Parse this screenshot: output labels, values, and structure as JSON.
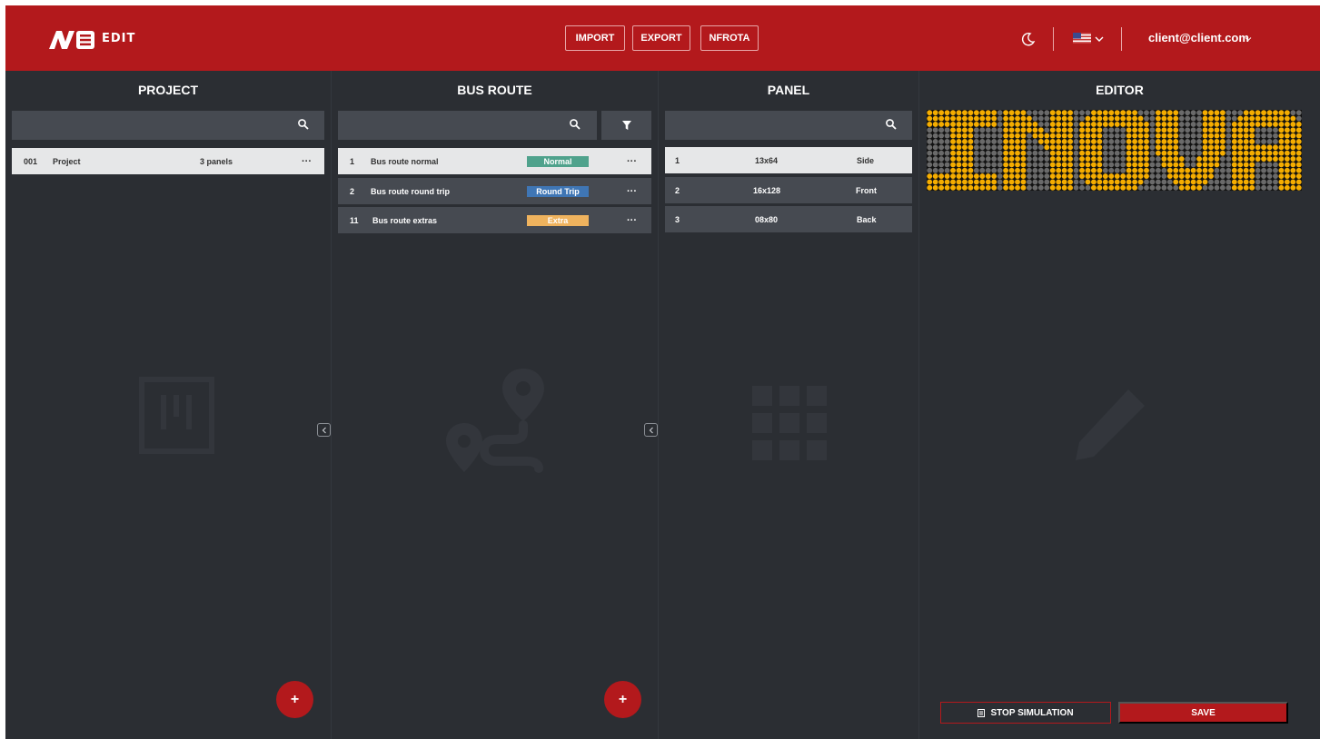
{
  "header": {
    "logo_text": "EDIT",
    "buttons": [
      "IMPORT",
      "EXPORT",
      "NFROTA"
    ],
    "user_email": "client@client.com",
    "theme_icon": "moon-icon",
    "language_icon": "us-flag-icon",
    "colors": {
      "brand": "#b3191c",
      "background": "#2b2e33",
      "row_dark": "#464a51"
    }
  },
  "project": {
    "title": "PROJECT",
    "search_placeholder": "",
    "items": [
      {
        "id": "001",
        "name": "Project",
        "count": "3 panels",
        "menu": "···"
      }
    ],
    "add_label": "+",
    "watermark_icon": "board-icon"
  },
  "bus_route": {
    "title": "BUS ROUTE",
    "search_placeholder": "",
    "items": [
      {
        "id": "1",
        "name": "Bus route normal",
        "type": "Normal",
        "type_color": "#4fa28c",
        "menu": "···"
      },
      {
        "id": "2",
        "name": "Bus route round trip",
        "type": "Round Trip",
        "type_color": "#3f76b5",
        "menu": "···"
      },
      {
        "id": "11",
        "name": "Bus route extras",
        "type": "Extra",
        "type_color": "#efb35e",
        "menu": "···"
      }
    ],
    "add_label": "+",
    "watermark_icon": "route-icon"
  },
  "panel": {
    "title": "PANEL",
    "search_placeholder": "",
    "items": [
      {
        "id": "1",
        "size": "13x64",
        "position": "Side"
      },
      {
        "id": "2",
        "size": "16x128",
        "position": "Front"
      },
      {
        "id": "3",
        "size": "08x80",
        "position": "Back"
      }
    ],
    "watermark_icon": "grid-icon"
  },
  "editor": {
    "title": "EDITOR",
    "display_text": "INOVA",
    "led_on_color": "#f5ad00",
    "led_off_color": "#6a6a6a",
    "stop_label": "STOP SIMULATION",
    "save_label": "SAVE",
    "watermark_icon": "pencil-icon"
  }
}
